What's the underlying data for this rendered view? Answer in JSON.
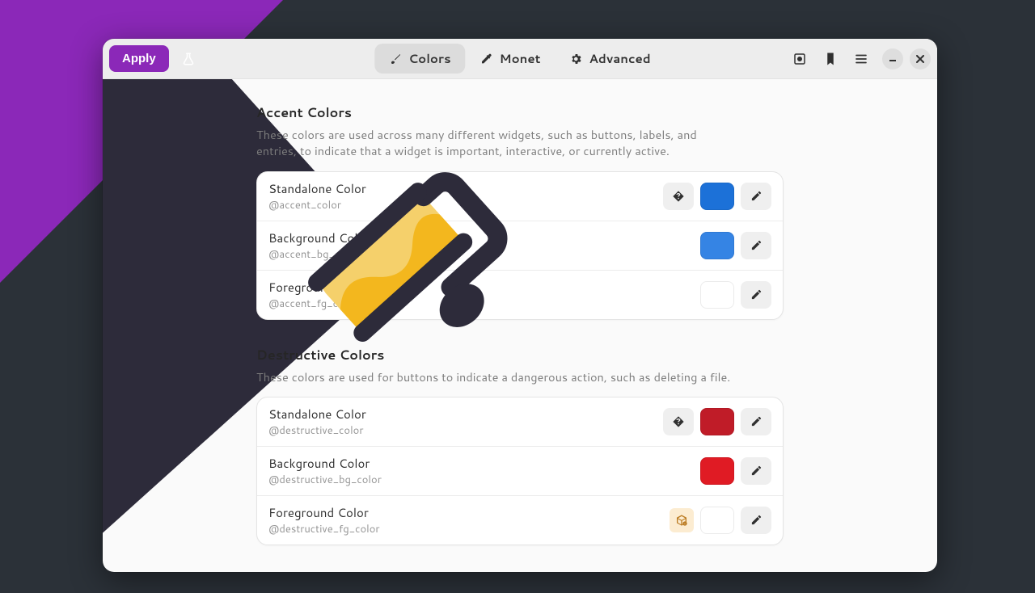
{
  "header": {
    "apply_label": "Apply",
    "tabs": {
      "colors": "Colors",
      "monet": "Monet",
      "advanced": "Advanced"
    }
  },
  "sections": {
    "accent": {
      "title": "Accent Colors",
      "desc": "These colors are used across many different widgets, such as buttons, labels, and entries, to indicate that a widget is important, interactive, or currently active.",
      "rows": {
        "standalone": {
          "title": "Standalone Color",
          "sub": "@accent_color",
          "color": "#1c71d8"
        },
        "background": {
          "title": "Background Color",
          "sub": "@accent_bg_color",
          "color": "#3584e4"
        },
        "foreground": {
          "title": "Foreground Color",
          "sub": "@accent_fg_color",
          "color": "#ffffff"
        }
      }
    },
    "destructive": {
      "title": "Destructive Colors",
      "desc": "These colors are used for buttons to indicate a dangerous action, such as deleting a file.",
      "rows": {
        "standalone": {
          "title": "Standalone Color",
          "sub": "@destructive_color",
          "color": "#c01c28"
        },
        "background": {
          "title": "Background Color",
          "sub": "@destructive_bg_color",
          "color": "#e01b24"
        },
        "foreground": {
          "title": "Foreground Color",
          "sub": "@destructive_fg_color",
          "color": "#ffffff"
        }
      }
    }
  }
}
